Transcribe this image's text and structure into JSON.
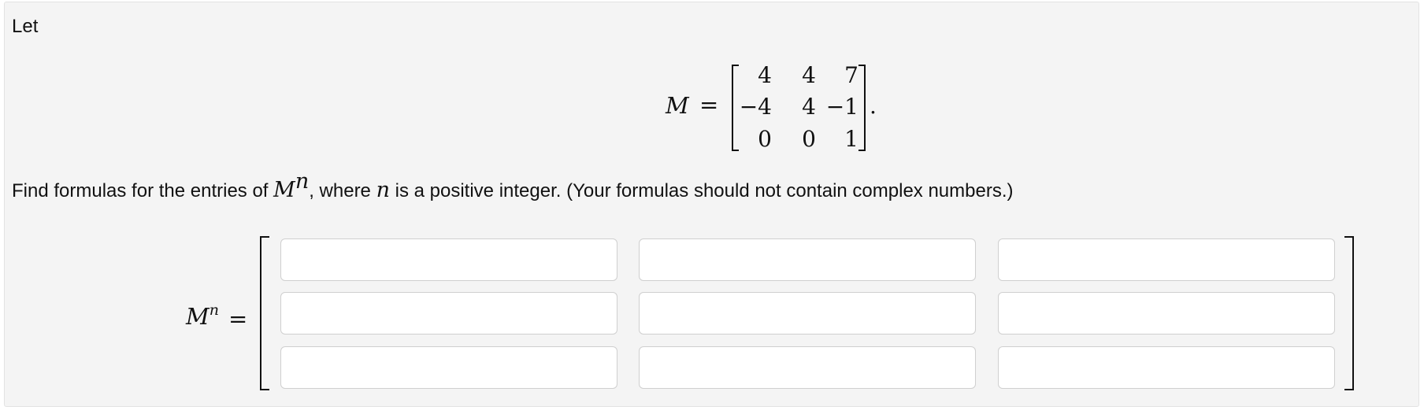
{
  "intro": "Let",
  "given_matrix": {
    "symbol": "M",
    "equals": "=",
    "rows": [
      [
        "4",
        "4",
        "7"
      ],
      [
        "−4",
        "4",
        "−1"
      ],
      [
        "0",
        "0",
        "1"
      ]
    ],
    "period": "."
  },
  "question": {
    "part1": "Find formulas for the entries of ",
    "matrix_symbol": "M",
    "exponent": "n",
    "part2": ", where ",
    "variable": "n",
    "part3": " is a positive integer. (Your formulas should not contain complex numbers.)"
  },
  "answer_matrix": {
    "symbol": "M",
    "exponent": "n",
    "equals": "=",
    "entries": [
      [
        "",
        "",
        ""
      ],
      [
        "",
        "",
        ""
      ],
      [
        "",
        "",
        ""
      ]
    ]
  }
}
